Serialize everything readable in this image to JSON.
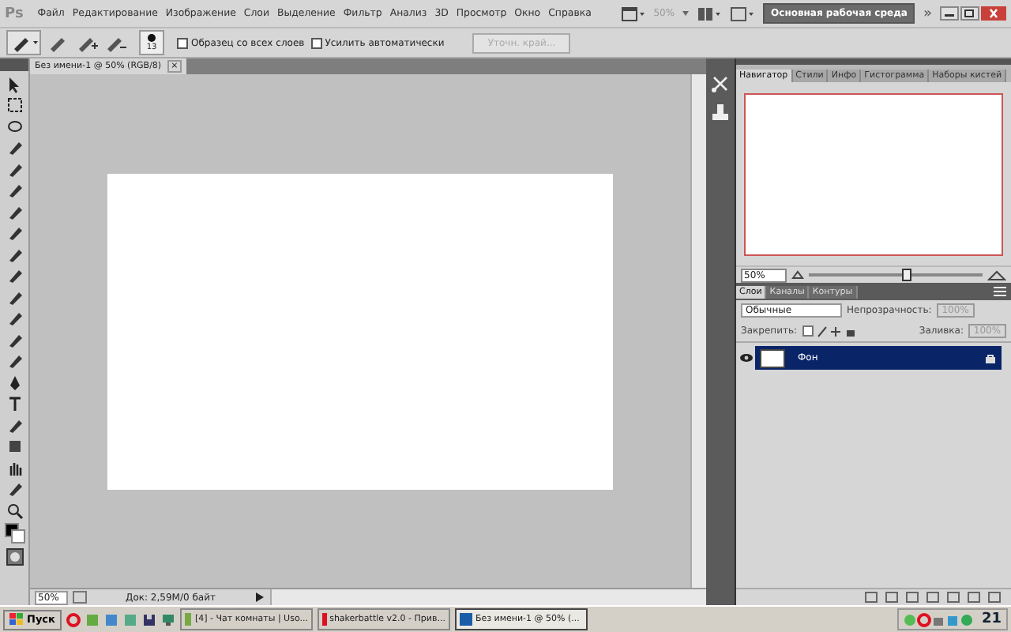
{
  "menu_bar": {
    "logo": "Ps",
    "items": [
      "Файл",
      "Редактирование",
      "Изображение",
      "Слои",
      "Выделение",
      "Фильтр",
      "Анализ",
      "3D",
      "Просмотр",
      "Окно",
      "Справка"
    ],
    "zoom": "50%",
    "workspace": "Основная рабочая среда",
    "more": "»"
  },
  "options_bar": {
    "brush_size": "13",
    "checkboxes": [
      {
        "label": "Образец со всех слоев",
        "checked": false
      },
      {
        "label": "Усилить автоматически",
        "checked": false
      }
    ],
    "button": {
      "label": "Уточн. край...",
      "disabled": true
    }
  },
  "document": {
    "tab": "Без имени-1 @ 50% (RGB/8)",
    "close": "×",
    "zoom": "50%",
    "status": "Док: 2,59M/0 байт"
  },
  "navigator": {
    "tabs": [
      {
        "label": "Навигатор",
        "selected": true
      },
      {
        "label": "Стили",
        "selected": false
      },
      {
        "label": "Инфо",
        "selected": false
      },
      {
        "label": "Гистограмма",
        "selected": false
      },
      {
        "label": "Наборы кистей",
        "selected": false
      }
    ],
    "zoom": "50%",
    "level": 0.55
  },
  "layers": {
    "tabs": [
      {
        "label": "Слои",
        "selected": true
      },
      {
        "label": "Каналы",
        "selected": false
      },
      {
        "label": "Контуры",
        "selected": false
      }
    ],
    "blend_mode": "Обычные",
    "opacity_label": "Непрозрачность:",
    "opacity": "100%",
    "lock_label": "Закрепить:",
    "fill_label": "Заливка:",
    "fill": "100%",
    "items": [
      {
        "name": "Фон",
        "selected": true,
        "visible": true,
        "locked": true
      }
    ]
  },
  "taskbar": {
    "start": "Пуск",
    "tasks": [
      {
        "label": "[4] - Чат комнаты | Uso...",
        "selected": false
      },
      {
        "label": "shakerbattle v2.0 - Прив...",
        "selected": false
      },
      {
        "label": "Без имени-1 @ 50% (...",
        "selected": true
      }
    ],
    "clock": "21"
  }
}
